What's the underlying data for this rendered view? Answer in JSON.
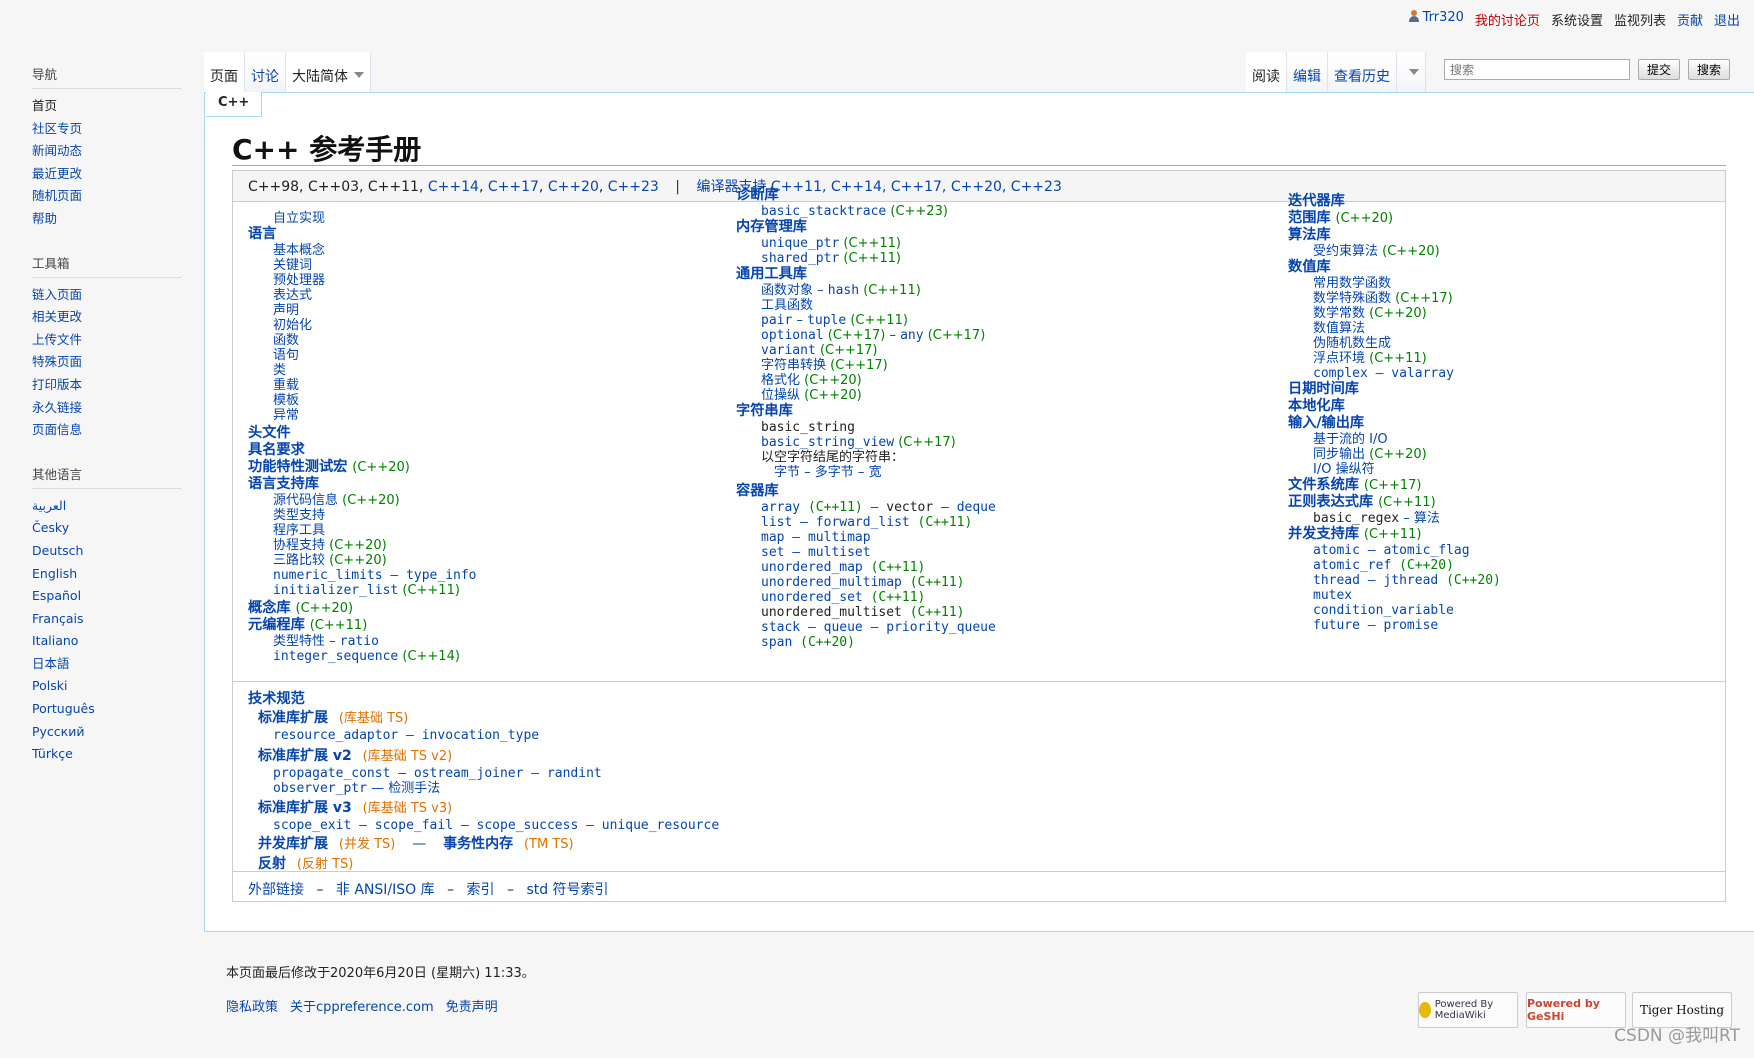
{
  "personal": {
    "user": "Trr320",
    "talk": "我的讨论页",
    "prefs": "系统设置",
    "watchlist": "监视列表",
    "contribs": "贡献",
    "logout": "退出"
  },
  "sidebar": {
    "nav_title": "导航",
    "nav": [
      "首页",
      "社区专页",
      "新闻动态",
      "最近更改",
      "随机页面",
      "帮助"
    ],
    "tools_title": "工具箱",
    "tools": [
      "链入页面",
      "相关更改",
      "上传文件",
      "特殊页面",
      "打印版本",
      "永久链接",
      "页面信息"
    ],
    "lang_title": "其他语言",
    "langs": [
      "العربية",
      "Česky",
      "Deutsch",
      "English",
      "Español",
      "Français",
      "Italiano",
      "日本語",
      "Polski",
      "Português",
      "Русский",
      "Türkçe"
    ]
  },
  "tabs": {
    "page": "页面",
    "talk": "讨论",
    "variant": "大陆简体",
    "read": "阅读",
    "edit": "编辑",
    "history": "查看历史"
  },
  "search": {
    "placeholder": "搜索",
    "go": "提交",
    "search": "搜索"
  },
  "page_tab": "C++",
  "title": "C++ 参考手册",
  "versions": {
    "plain": "C++98, C++03,",
    "cxx11": "C++11",
    "cxx14": "C++14",
    "cxx17": "C++17",
    "cxx20": "C++20",
    "cxx23": "C++23",
    "compiler_label": "编译器支持"
  },
  "c": {
    "self_impl": "自立实现",
    "language": "语言",
    "basic_concepts": "基本概念",
    "keywords": "关键词",
    "preprocessor": "预处理器",
    "expressions": "表达式",
    "declaration": "声明",
    "initialization": "初始化",
    "functions": "函数",
    "statements": "语句",
    "classes": "类",
    "overloading": "重载",
    "templates": "模板",
    "exceptions": "异常",
    "headers": "头文件",
    "named_req": "具名要求",
    "feature_test": "功能特性测试宏",
    "lang_support": "语言支持库",
    "source_location": "源代码信息",
    "type_support": "类型支持",
    "program_utils": "程序工具",
    "coroutine": "协程支持",
    "three_way": "三路比较",
    "numeric_limits": "numeric_limits",
    "type_info": "type_info",
    "initializer_list": "initializer_list",
    "concepts": "概念库",
    "metaprog": "元编程库",
    "type_traits": "类型特性",
    "ratio": "ratio",
    "integer_sequence": "integer_sequence",
    "diagnostics": "诊断库",
    "basic_stacktrace": "basic_stacktrace",
    "memory": "内存管理库",
    "unique_ptr": "unique_ptr",
    "shared_ptr": "shared_ptr",
    "utilities": "通用工具库",
    "function_objects": "函数对象",
    "hash": "hash",
    "utility_functions": "工具函数",
    "pair": "pair",
    "tuple": "tuple",
    "optional": "optional",
    "any": "any",
    "variant": "variant",
    "string_conv": "字符串转换",
    "format": "格式化",
    "bit": "位操纵",
    "strings": "字符串库",
    "basic_string": "basic_string",
    "basic_string_view": "basic_string_view",
    "null_terminated": "以空字符结尾的字符串：",
    "byte": "字节",
    "multibyte": "多字节",
    "wide": "宽",
    "containers": "容器库",
    "array": "array",
    "vector": "vector",
    "deque": "deque",
    "list": "list",
    "forward_list": "forward_list",
    "map": "map",
    "multimap": "multimap",
    "set": "set",
    "multiset": "multiset",
    "unordered_map": "unordered_map",
    "unordered_multimap": "unordered_multimap",
    "unordered_set": "unordered_set",
    "unordered_multiset": "unordered_multiset",
    "stack": "stack",
    "queue": "queue",
    "priority_queue": "priority_queue",
    "span": "span",
    "iterators": "迭代器库",
    "ranges": "范围库",
    "algorithms": "算法库",
    "constrained_alg": "受约束算法",
    "numerics": "数值库",
    "common_math": "常用数学函数",
    "special_math": "数学特殊函数",
    "math_constants": "数学常数",
    "numeric_alg": "数值算法",
    "prng": "伪随机数生成",
    "fenv": "浮点环境",
    "complex": "complex",
    "valarray": "valarray",
    "chrono": "日期时间库",
    "locale": "本地化库",
    "io": "输入/输出库",
    "stream_io": "基于流的 I/O",
    "sync_out": "同步输出",
    "io_manip": "I/O 操纵符",
    "filesystem": "文件系统库",
    "regex": "正则表达式库",
    "basic_regex": "basic_regex",
    "regex_alg": "算法",
    "thread_support": "并发支持库",
    "atomic": "atomic",
    "atomic_flag": "atomic_flag",
    "atomic_ref": "atomic_ref",
    "thread": "thread",
    "jthread": "jthread",
    "mutex": "mutex",
    "condition_variable": "condition_variable",
    "future": "future",
    "promise": "promise"
  },
  "tech": {
    "title": "技术规范",
    "libext": "标准库扩展",
    "libext_tag": "(库基础 TS)",
    "resource_adaptor": "resource_adaptor",
    "invocation_type": "invocation_type",
    "libext2": "标准库扩展 v2",
    "libext2_tag": "(库基础 TS v2)",
    "propagate_const": "propagate_const",
    "ostream_joiner": "ostream_joiner",
    "randint": "randint",
    "observer_ptr": "observer_ptr",
    "detection": "检测手法",
    "libext3": "标准库扩展 v3",
    "libext3_tag": "(库基础 TS v3)",
    "scope_exit": "scope_exit",
    "scope_fail": "scope_fail",
    "scope_success": "scope_success",
    "unique_resource": "unique_resource",
    "concurrency": "并发库扩展",
    "concurrency_tag": "(并发 TS)",
    "tm": "事务性内存",
    "tm_tag": "(TM TS)",
    "reflection": "反射",
    "reflection_tag": "(反射 TS)"
  },
  "bottom_links": {
    "external": "外部链接",
    "non_ansi": "非 ANSI/ISO 库",
    "index": "索引",
    "symbol_index": "std 符号索引"
  },
  "footer": {
    "modified": "本页面最后修改于2020年6月20日 (星期六) 11:33。",
    "privacy": "隐私政策",
    "about": "关于cppreference.com",
    "disclaimer": "免责声明"
  },
  "badges": {
    "mediawiki": "Powered By MediaWiki",
    "geshi": "Powered by GeSHi",
    "tiger": "Tiger Hosting"
  },
  "watermark": "CSDN @我叫RT",
  "colors": {
    "link": "#0645ad",
    "version": "#008000",
    "ts": "#e07000",
    "user_link": "#ba0000"
  }
}
